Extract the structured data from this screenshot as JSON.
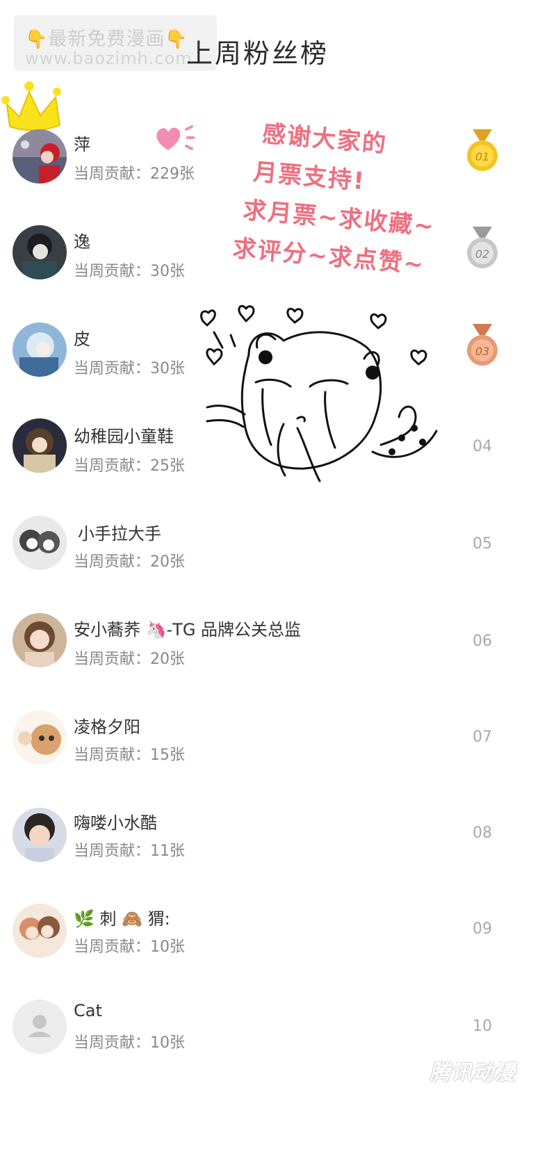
{
  "watermark": {
    "line1": "最新免费漫画",
    "line2": "www.baozimh.com",
    "hand_icon": "👇"
  },
  "page_title": "上周粉丝榜",
  "fans": [
    {
      "name": "萍",
      "contribution": "当周贡献：229张",
      "rank": "01",
      "medal": "gold"
    },
    {
      "name": "逸",
      "contribution": "当周贡献：30张",
      "rank": "02",
      "medal": "silver"
    },
    {
      "name": "皮",
      "contribution": "当周贡献：30张",
      "rank": "03",
      "medal": "bronze"
    },
    {
      "name": "幼稚园小童鞋",
      "contribution": "当周贡献：25张",
      "rank": "04"
    },
    {
      "name": "小手拉大手",
      "contribution": "当周贡献：20张",
      "rank": "05"
    },
    {
      "name": "安小蕎荞 🦄-TG 品牌公关总监",
      "contribution": "当周贡献：20张",
      "rank": "06"
    },
    {
      "name": "凌格夕阳",
      "contribution": "当周贡献：15张",
      "rank": "07"
    },
    {
      "name": "嗨喽小水酷",
      "contribution": "当周贡献：11张",
      "rank": "08"
    },
    {
      "name": "🌿 刺 🙈 猬:",
      "contribution": "当周贡献：10张",
      "rank": "09"
    },
    {
      "name": "Cat",
      "contribution": "当周贡献：10张",
      "rank": "10"
    }
  ],
  "cheer_text": {
    "line1": "感谢大家的",
    "line2": "月票支持!",
    "line3": "求月票~求收藏~",
    "line4": "求评分~求点赞~"
  },
  "colors": {
    "cheer": "#ee6f80",
    "gold": "#f6c21d",
    "silver": "#b8b8b8",
    "bronze": "#e89a74",
    "crown": "#f9e21c"
  },
  "footer_watermark": "腾讯动漫"
}
